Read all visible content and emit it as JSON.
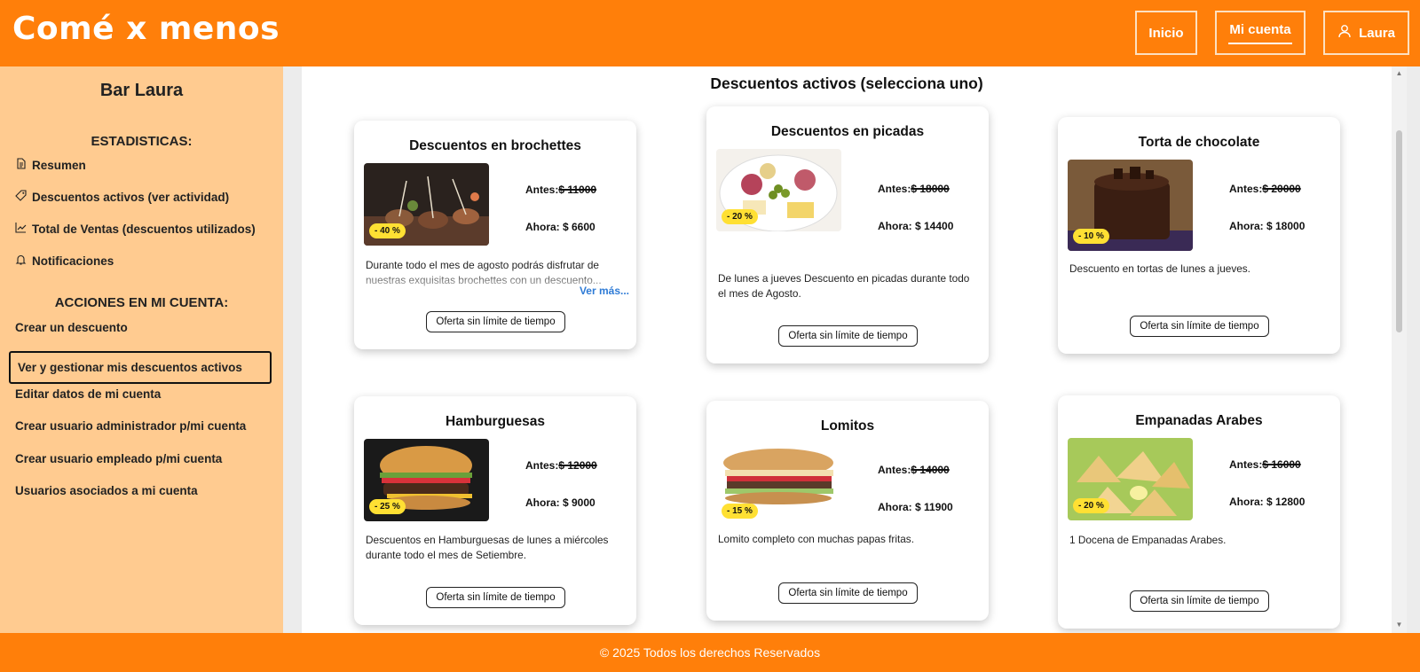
{
  "header": {
    "logo": "Comé x menos",
    "nav": {
      "inicio": "Inicio",
      "mi_cuenta": "Mi cuenta",
      "user": "Laura"
    }
  },
  "sidebar": {
    "title": "Bar Laura",
    "stats_heading": "ESTADISTICAS:",
    "stats_items": [
      {
        "label": "Resumen",
        "icon": "document-icon"
      },
      {
        "label": "Descuentos activos (ver actividad)",
        "icon": "tag-icon"
      },
      {
        "label": "Total de Ventas (descuentos utilizados)",
        "icon": "chart-line-icon"
      },
      {
        "label": "Notificaciones",
        "icon": "bell-icon"
      }
    ],
    "actions_heading": "ACCIONES EN MI CUENTA:",
    "action_items": [
      "Crear un descuento",
      "Ver y gestionar mis descuentos activos",
      "Editar datos de mi cuenta",
      "Crear usuario administrador p/mi cuenta",
      "Crear usuario empleado p/mi cuenta",
      "Usuarios asociados a mi cuenta"
    ],
    "active_index": 1
  },
  "main": {
    "title": "Descuentos activos (selecciona uno)",
    "cards": [
      {
        "title": "Descuentos en brochettes",
        "badge": "- 40 %",
        "antes_label": "Antes:",
        "antes": "$ 11000",
        "ahora": "Ahora: $ 6600",
        "desc": "Durante todo el mes de agosto podrás disfrutar de nuestras exquisitas brochettes con un descuento...",
        "ver_mas": "Ver más...",
        "offer": "Oferta sin límite de tiempo",
        "image": "brochettes"
      },
      {
        "title": "Descuentos en picadas",
        "badge": "- 20 %",
        "antes_label": "Antes:",
        "antes": "$ 18000",
        "ahora": "Ahora: $ 14400",
        "desc": "De lunes a jueves Descuento en picadas durante todo el mes de Agosto.",
        "offer": "Oferta sin límite de tiempo",
        "image": "picada"
      },
      {
        "title": "Torta de chocolate",
        "badge": "- 10 %",
        "antes_label": "Antes:",
        "antes": "$ 20000",
        "ahora": "Ahora: $ 18000",
        "desc": "Descuento en tortas de lunes a jueves.",
        "offer": "Oferta sin límite de tiempo",
        "image": "cake"
      },
      {
        "title": "Hamburguesas",
        "badge": "- 25 %",
        "antes_label": "Antes:",
        "antes": "$ 12000",
        "ahora": "Ahora: $ 9000",
        "desc": "Descuentos en Hamburguesas de lunes a miércoles durante todo el mes de Setiembre.",
        "offer": "Oferta sin límite de tiempo",
        "image": "burger"
      },
      {
        "title": "Lomitos",
        "badge": "- 15 %",
        "antes_label": "Antes:",
        "antes": "$ 14000",
        "ahora": "Ahora: $ 11900",
        "desc": "Lomito completo con muchas papas fritas.",
        "offer": "Oferta sin límite de tiempo",
        "image": "lomito"
      },
      {
        "title": "Empanadas Arabes",
        "badge": "- 20 %",
        "antes_label": "Antes:",
        "antes": "$ 16000",
        "ahora": "Ahora: $ 12800",
        "desc": "1 Docena de Empanadas Arabes.",
        "offer": "Oferta sin límite de tiempo",
        "image": "empanadas"
      }
    ]
  },
  "footer": {
    "text": "© 2025 Todos los derechos Reservados"
  },
  "colors": {
    "brand": "#ff7f0a",
    "sidebar": "#ffcb90",
    "badge": "#ffe033",
    "link": "#2e7bd6"
  }
}
